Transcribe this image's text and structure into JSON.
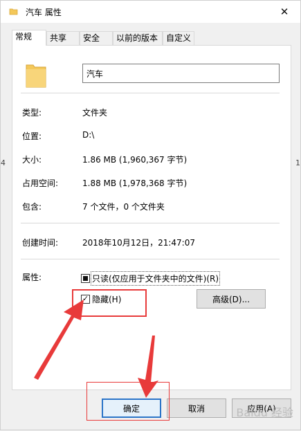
{
  "window": {
    "title": "汽车 属性",
    "close_symbol": "✕"
  },
  "side_marks": {
    "left": "4",
    "right": "1"
  },
  "tabs": [
    {
      "label": "常规",
      "active": true
    },
    {
      "label": "共享"
    },
    {
      "label": "安全"
    },
    {
      "label": "以前的版本"
    },
    {
      "label": "自定义"
    }
  ],
  "general": {
    "name_value": "汽车",
    "rows": [
      {
        "label": "类型:",
        "value": "文件夹"
      },
      {
        "label": "位置:",
        "value": "D:\\"
      },
      {
        "label": "大小:",
        "value": "1.86 MB (1,960,367 字节)"
      },
      {
        "label": "占用空间:",
        "value": "1.88 MB (1,978,368 字节)"
      },
      {
        "label": "包含:",
        "value": "7 个文件，0 个文件夹"
      }
    ],
    "created": {
      "label": "创建时间:",
      "value": "2018年10月12日，21:47:07"
    },
    "attributes": {
      "label": "属性:",
      "readonly_label": "只读(仅应用于文件夹中的文件)(R)",
      "hidden_label": "隐藏(H)",
      "advanced_label": "高级(D)..."
    }
  },
  "footer": {
    "ok": "确定",
    "cancel": "取消",
    "apply": "应用(A)"
  },
  "watermark": "Baidu 经验",
  "colors": {
    "annotation": "#e83a3a",
    "folder": "#f4c85a",
    "default_button_border": "#2a74c8"
  }
}
